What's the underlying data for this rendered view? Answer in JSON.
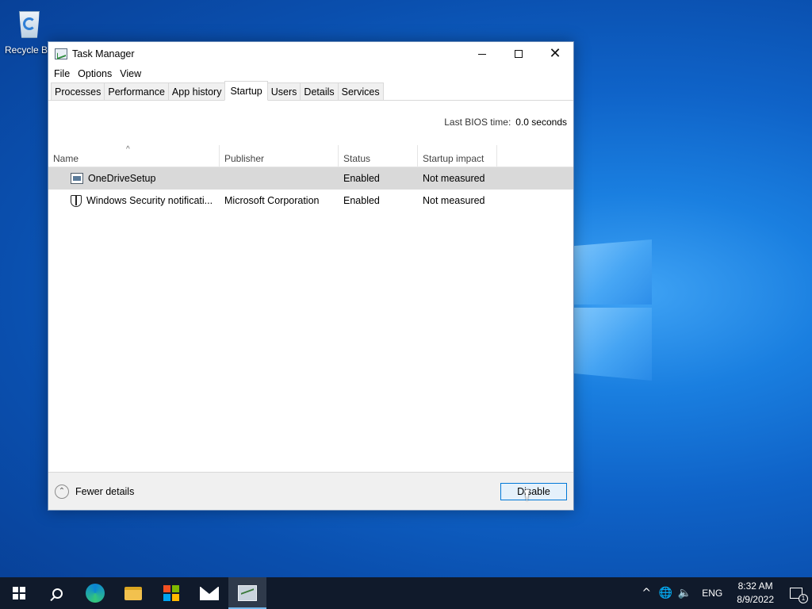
{
  "desktop": {
    "recycle_bin_label": "Recycle Bin"
  },
  "window": {
    "title": "Task Manager",
    "controls": {
      "minimize": "",
      "maximize": "",
      "close": "✕"
    },
    "menu": [
      "File",
      "Options",
      "View"
    ],
    "tabs": [
      "Processes",
      "Performance",
      "App history",
      "Startup",
      "Users",
      "Details",
      "Services"
    ],
    "active_tab": "Startup",
    "bios_label": "Last BIOS time:",
    "bios_value": "0.0 seconds",
    "columns": [
      "Name",
      "Publisher",
      "Status",
      "Startup impact"
    ],
    "sort_indicator": "^",
    "rows": [
      {
        "name": "OneDriveSetup",
        "publisher": "",
        "status": "Enabled",
        "impact": "Not measured",
        "icon": "app-window-icon",
        "selected": true
      },
      {
        "name": "Windows Security notificati...",
        "publisher": "Microsoft Corporation",
        "status": "Enabled",
        "impact": "Not measured",
        "icon": "shield-icon",
        "selected": false
      }
    ],
    "fewer_details": "Fewer details",
    "fewer_details_icon": "⌃",
    "disable_button": "Disable"
  },
  "taskbar": {
    "tray_up_arrow": "^",
    "network_icon": "🌐",
    "volume_icon": "🔈",
    "language": "ENG",
    "time": "8:32 AM",
    "date": "8/9/2022",
    "notification_count": "1"
  },
  "colors": {
    "accent": "#0078d7",
    "selected_row": "#d9d9d9",
    "taskbar": "#101a2b"
  }
}
